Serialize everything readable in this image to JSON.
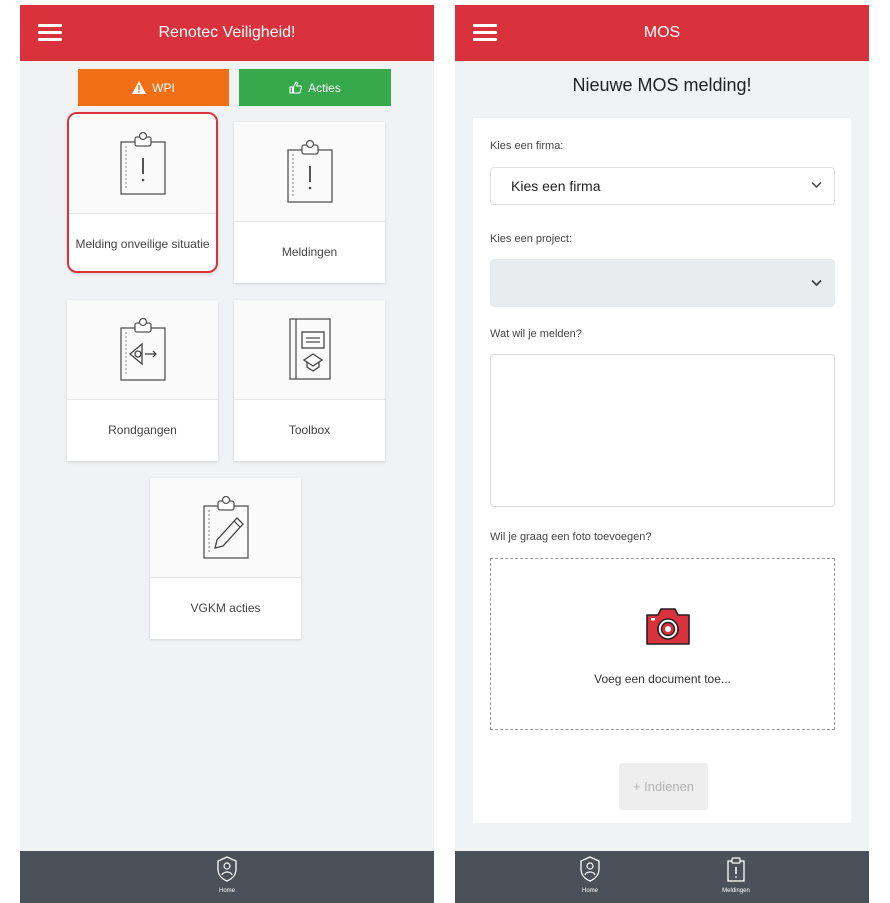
{
  "left": {
    "header": {
      "title": "Renotec Veiligheid!"
    },
    "quick_buttons": {
      "wpi": "WPI",
      "acties": "Acties"
    },
    "tiles": [
      {
        "label": "Melding onveilige situatie",
        "icon": "clipboard-alert-icon"
      },
      {
        "label": "Meldingen",
        "icon": "clipboard-alert-icon"
      },
      {
        "label": "Rondgangen",
        "icon": "clipboard-eye-icon"
      },
      {
        "label": "Toolbox",
        "icon": "toolbox-book-icon"
      },
      {
        "label": "VGKM acties",
        "icon": "clipboard-pencil-icon"
      }
    ],
    "bottom_nav": [
      {
        "label": "Home",
        "icon": "shield-user-icon"
      }
    ]
  },
  "right": {
    "header": {
      "title": "MOS"
    },
    "form": {
      "title": "Nieuwe MOS melding!",
      "firma_label": "Kies een firma:",
      "firma_value": "Kies een firma",
      "project_label": "Kies een project:",
      "project_value": "",
      "message_label": "Wat wil je melden?",
      "message_value": "",
      "photo_label": "Wil je graag een foto toevoegen?",
      "upload_text": "Voeg een document toe...",
      "submit_label": "+ Indienen"
    },
    "bottom_nav": [
      {
        "label": "Home",
        "icon": "shield-user-icon"
      },
      {
        "label": "Meldingen",
        "icon": "clipboard-alert-icon"
      }
    ]
  },
  "colors": {
    "header": "#d9323d",
    "wpi_button": "#f36f16",
    "acties_button": "#35a94b",
    "bottom_bar": "#4b5158",
    "camera": "#d9323d"
  }
}
